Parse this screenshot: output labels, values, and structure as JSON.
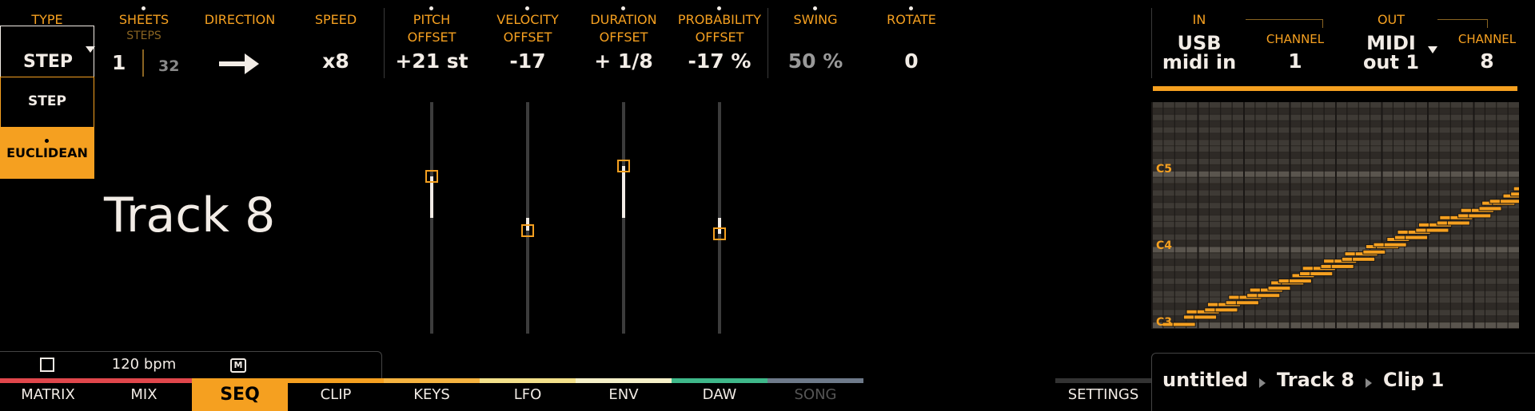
{
  "colors": {
    "accent": "#f5a020",
    "text": "#f2ece6",
    "dim": "#888888",
    "background": "#000000"
  },
  "type_selector": {
    "label": "TYPE",
    "value": "STEP",
    "options": [
      "STEP",
      "EUCLIDEAN"
    ],
    "selected_option": "EUCLIDEAN"
  },
  "sheets": {
    "label": "SHEETS",
    "sublabel": "STEPS",
    "sheet_value": "1",
    "steps_value": "32"
  },
  "direction": {
    "label": "DIRECTION",
    "icon": "arrow-right-icon"
  },
  "speed": {
    "label": "SPEED",
    "value": "x8"
  },
  "pitch_offset": {
    "label1": "PITCH",
    "label2": "OFFSET",
    "value": "+21 st",
    "level": 0.36
  },
  "velocity_offset": {
    "label1": "VELOCITY",
    "label2": "OFFSET",
    "value": "-17",
    "level": -0.11
  },
  "duration_offset": {
    "label1": "DURATION",
    "label2": "OFFSET",
    "value": "+ 1/8",
    "level": 0.45
  },
  "probability_offset": {
    "label1": "PROBABILITY",
    "label2": "OFFSET",
    "value": "-17 %",
    "level": -0.14
  },
  "swing": {
    "label": "SWING",
    "value": "50 %"
  },
  "rotate": {
    "label": "ROTATE",
    "value": "0"
  },
  "track_title": "Track 8",
  "midi_in": {
    "label": "IN",
    "value1": "USB",
    "value2": "midi in",
    "channel_label": "CHANNEL",
    "channel_value": "1"
  },
  "midi_out": {
    "label": "OUT",
    "value1": "MIDI",
    "value2": "out 1",
    "channel_label": "CHANNEL",
    "channel_value": "8"
  },
  "piano_roll": {
    "notes": [
      "C5",
      "C4",
      "C3"
    ]
  },
  "status_bar": {
    "bpm": "120 bpm",
    "metronome": "M"
  },
  "tabs": [
    {
      "label": "MATRIX",
      "color": "#e0474c"
    },
    {
      "label": "MIX",
      "color": "#e0474c"
    },
    {
      "label": "SEQ",
      "color": "#f5a020",
      "active": true
    },
    {
      "label": "CLIP",
      "color": "#f5a020"
    },
    {
      "label": "KEYS",
      "color": "#f5b340"
    },
    {
      "label": "LFO",
      "color": "#f3e08a"
    },
    {
      "label": "ENV",
      "color": "#f5f0c8"
    },
    {
      "label": "DAW",
      "color": "#3fb88a"
    },
    {
      "label": "SONG",
      "color": "#6e7a8a",
      "disabled": true
    }
  ],
  "settings_tab": {
    "label": "SETTINGS"
  },
  "breadcrumb": {
    "project": "untitled",
    "track": "Track 8",
    "clip": "Clip 1"
  }
}
